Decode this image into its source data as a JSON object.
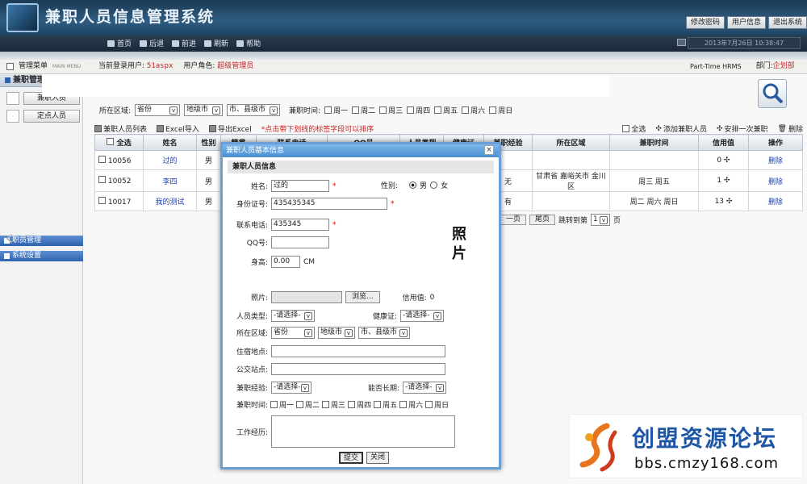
{
  "header": {
    "title": "兼职人员信息管理系统",
    "buttons": [
      "修改密码",
      "用户信息",
      "退出系统"
    ]
  },
  "nav": {
    "items": [
      "首页",
      "后退",
      "前进",
      "刷新",
      "帮助"
    ],
    "datetime": "2013年7月26日 10:38:47"
  },
  "infobar": {
    "menu_label": "管理菜单",
    "menu_sub": "MAIN MENU",
    "current_user_label": "当前登录用户:",
    "current_user": "51aspx",
    "role_label": "用户角色:",
    "role": "超级管理员",
    "system_en": "Part-Time HRMS",
    "dept_label": "部门:",
    "dept": "企划部"
  },
  "sidebar": {
    "section_parttime": "兼职管理",
    "links": [
      "兼职人员",
      "定点人员"
    ],
    "section_staff": "职员管理",
    "section_system": "系统设置"
  },
  "filter": {
    "region_label": "所在区域:",
    "province": "省份",
    "city": "地级市",
    "county": "市、县级市",
    "time_label": "兼职时间:",
    "days": [
      "周一",
      "周二",
      "周三",
      "周四",
      "周五",
      "周六",
      "周日"
    ]
  },
  "toolbar": {
    "list": "兼职人员列表",
    "excel_import": "Excel导入",
    "excel_export": "导出Excel",
    "tip": "*点击带下划线的标签字段可以排序",
    "select_all": "全选",
    "add": "添加兼职人员",
    "arrange": "安排一次兼职",
    "delete": "删除"
  },
  "table": {
    "headers": [
      "全选",
      "姓名",
      "性别",
      "籍贯",
      "联系电话",
      "QQ号",
      "人员类型",
      "健康证",
      "兼职经验",
      "所在区域",
      "兼职时间",
      "信用值",
      "操作"
    ],
    "rows": [
      {
        "id": "10056",
        "name": "过的",
        "gender": "男",
        "experience": "",
        "region": "",
        "time": "",
        "credit": "0",
        "action": "删除"
      },
      {
        "id": "10052",
        "name": "李四",
        "gender": "男",
        "experience": "无",
        "region": "甘肃省 嘉峪关市 金川区",
        "time": "周三 周五",
        "credit": "1",
        "action": "删除"
      },
      {
        "id": "10017",
        "name": "我的测试",
        "gender": "男",
        "experience": "有",
        "region": "",
        "time": "周二 周六 周日",
        "credit": "13",
        "action": "删除"
      }
    ]
  },
  "pager": {
    "next": "一页",
    "last": "尾页",
    "jump_label": "跳转到第",
    "page": "1",
    "unit": "页"
  },
  "modal": {
    "title": "兼职人员基本信息",
    "section": "兼职人员信息",
    "name_label": "姓名:",
    "name": "过的",
    "gender_label": "性别:",
    "male": "男",
    "female": "女",
    "id_label": "身份证号:",
    "id_number": "435435345",
    "phone_label": "联系电话:",
    "phone": "435345",
    "qq_label": "QQ号:",
    "height_label": "身高:",
    "height": "0.00",
    "height_unit": "CM",
    "photo_text": "照片",
    "photo_label": "照片:",
    "browse": "浏览...",
    "credit_label": "信用值:",
    "credit": "0",
    "type_label": "人员类型:",
    "type_value": "-请选择-",
    "health_label": "健康证:",
    "health_value": "-请选择-",
    "region_label": "所在区域:",
    "province": "省份",
    "city": "地级市",
    "county": "市、县级市",
    "address_label": "住宿地点:",
    "bus_label": "公交站点:",
    "exp_label": "兼职经验:",
    "exp_value": "-请选择-",
    "longterm_label": "能否长期:",
    "longterm_value": "-请选择-",
    "time_label": "兼职时间:",
    "days": [
      "周一",
      "周二",
      "周三",
      "周四",
      "周五",
      "周六",
      "周日"
    ],
    "resume_label": "工作经历:",
    "submit": "提交",
    "close": "关闭"
  },
  "watermark": {
    "name": "创盟资源论坛",
    "url": "bbs.cmzy168.com"
  },
  "colors": {
    "header_bg": "#2e5c80",
    "accent_red": "#c0282c",
    "link_blue": "#1a3fb0",
    "modal_border": "#6aa0d6"
  }
}
